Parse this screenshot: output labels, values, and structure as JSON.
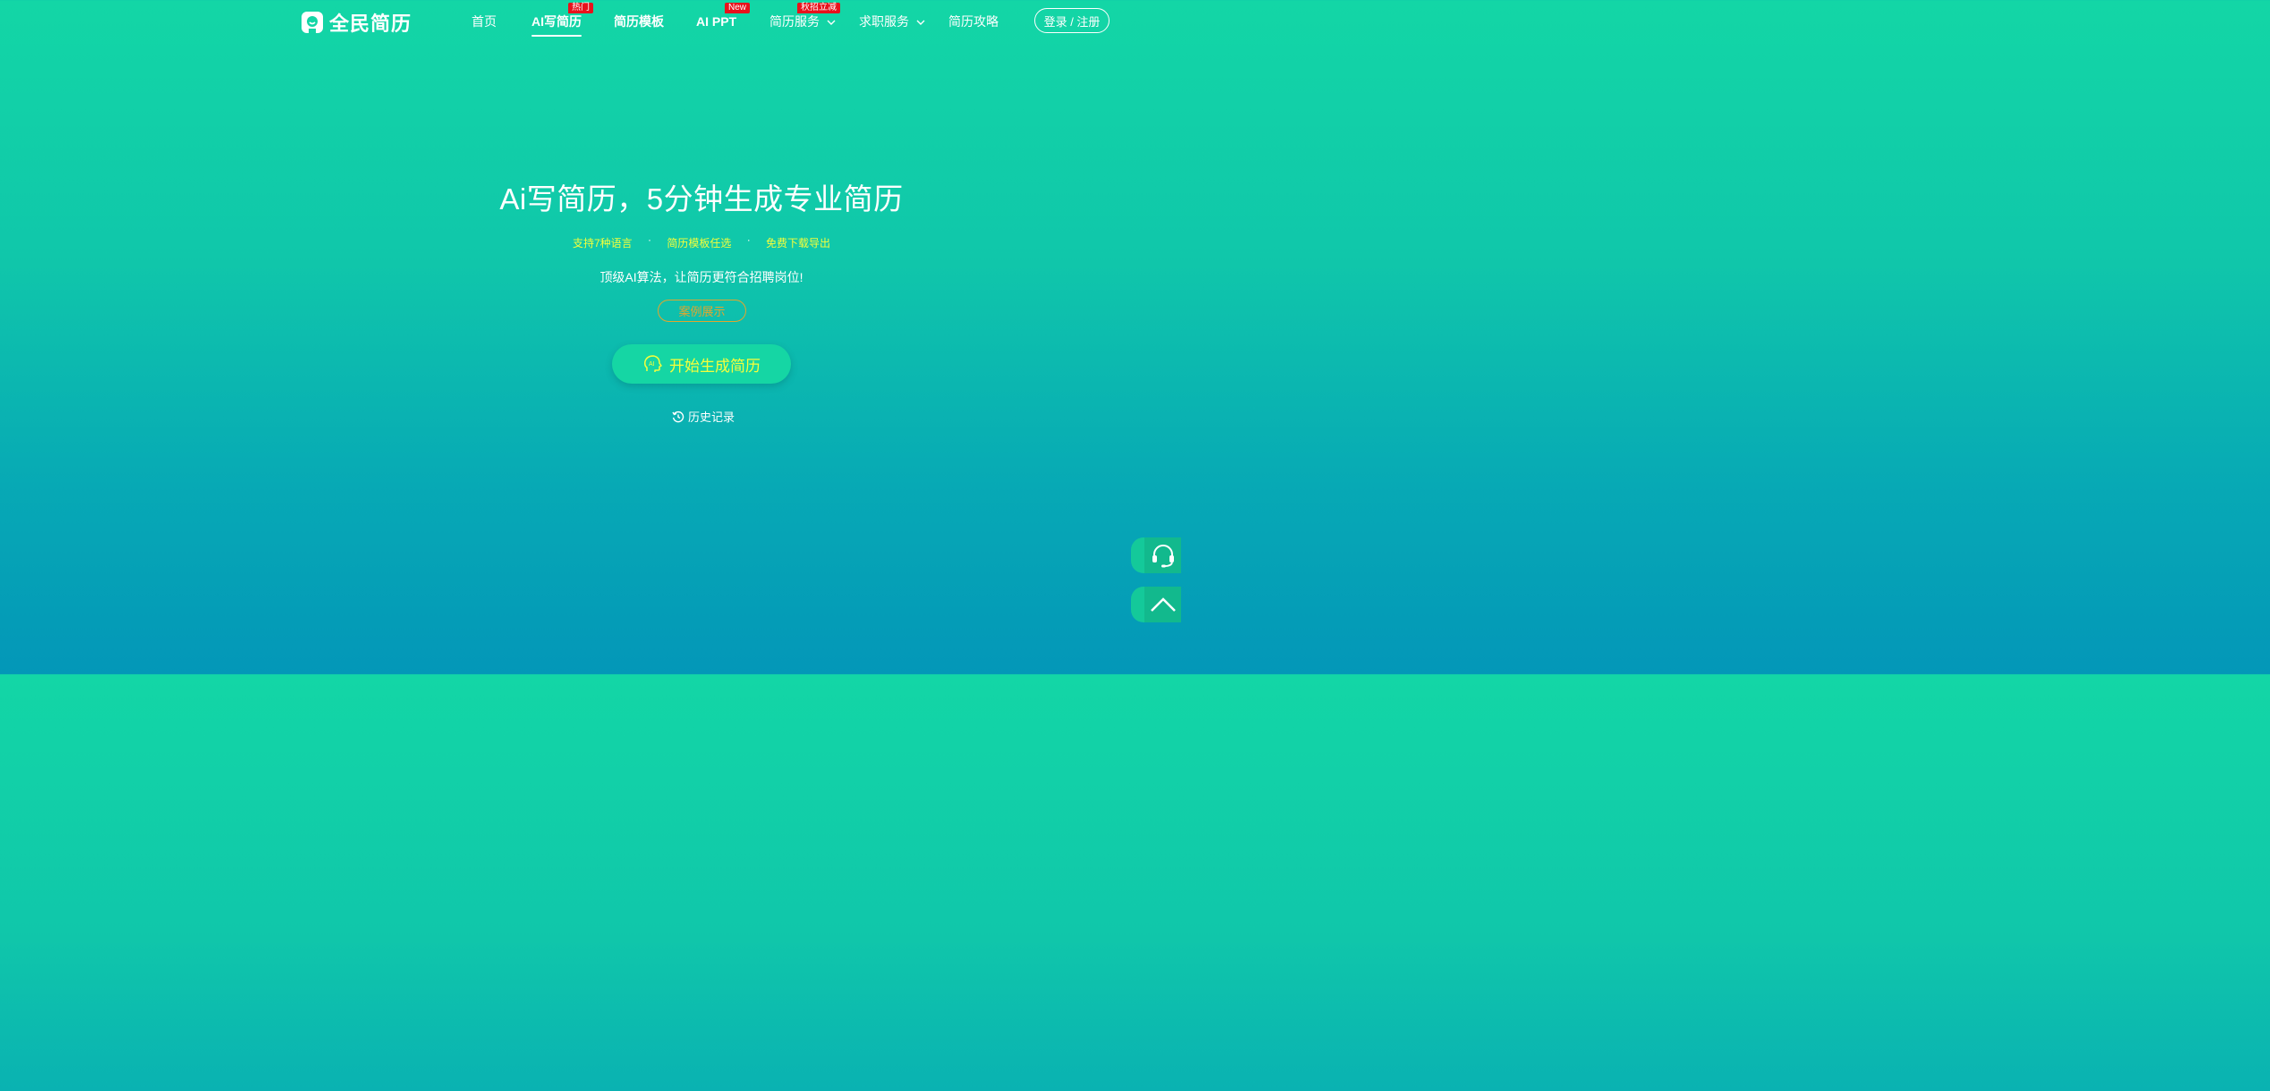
{
  "header": {
    "logo_text": "全民简历",
    "nav": [
      {
        "label": "首页",
        "bold": false
      },
      {
        "label": "AI写简历",
        "bold": true,
        "badge": "热门",
        "active": true
      },
      {
        "label": "简历模板",
        "bold": true
      },
      {
        "label": "AI PPT",
        "bold": true,
        "badge": "New"
      },
      {
        "label": "简历服务",
        "bold": false,
        "badge": "秋招立减",
        "dropdown": true
      },
      {
        "label": "求职服务",
        "bold": false,
        "dropdown": true
      },
      {
        "label": "简历攻略",
        "bold": false
      }
    ],
    "login_label": "登录 / 注册"
  },
  "hero": {
    "title": "Ai写简历，5分钟生成专业简历",
    "features": [
      "支持7种语言",
      "简历模板任选",
      "免费下载导出"
    ],
    "feature_separator": "·",
    "subtitle": "顶级AI算法，让简历更符合招聘岗位!",
    "case_button": "案例展示",
    "start_button": "开始生成简历",
    "history_link": "历史记录"
  },
  "floating": {
    "support_icon": "headset-icon",
    "top_icon": "chevron-up-icon"
  },
  "colors": {
    "gradient_top": "#13d6a6",
    "gradient_bottom": "#0397b8",
    "highlight_yellow": "#f5ff3b",
    "badge_red": "#e8121c",
    "case_orange": "#e3a62d"
  }
}
